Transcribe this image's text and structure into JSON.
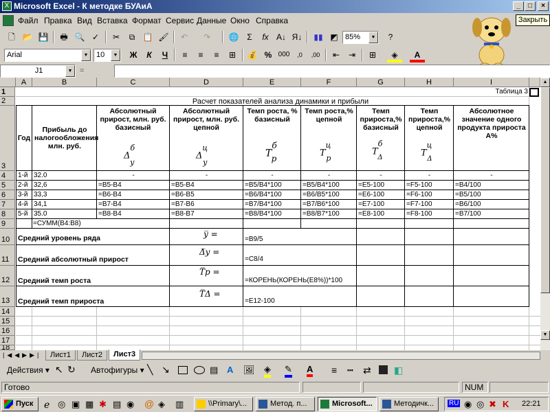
{
  "window": {
    "title": "Microsoft Excel - К методке БУАиА",
    "close_tooltip": "Закрыть"
  },
  "menu": [
    "Файл",
    "Правка",
    "Вид",
    "Вставка",
    "Формат",
    "Сервис",
    "Данные",
    "Окно",
    "Справка"
  ],
  "toolbar": {
    "zoom": "85%",
    "font": "Arial",
    "size": "10",
    "bold": "Ж",
    "italic": "К",
    "underline": "Ч",
    "percent": "%",
    "thousands": "000"
  },
  "formula": {
    "namebox": "J1",
    "content": ""
  },
  "columns": [
    "A",
    "B",
    "C",
    "D",
    "E",
    "F",
    "G",
    "H",
    "I"
  ],
  "rows": [
    "1",
    "2",
    "3",
    "4",
    "5",
    "6",
    "7",
    "8",
    "9",
    "10",
    "11",
    "12",
    "13",
    "14",
    "15",
    "16",
    "17",
    "18"
  ],
  "sheet": {
    "table_no": "Таблица 3",
    "title": "Расчет показателей анализа динамики и прибыли",
    "headers": {
      "A": "Год",
      "B": "Прибыль до налогообложения млн. руб.",
      "C": "Абсолютный прирост, млн. руб. базисный",
      "D": "Абсолютный прирост, млн. руб. цепной",
      "E": "Темп роста, % базисный",
      "F": "Темп роста,% цепной",
      "G": "Темп прироста,% базисный",
      "H": "Темп прироста,% цепной",
      "I": "Абсолютное значение одного продукта прироста А%"
    },
    "symbols": {
      "C": "Δ",
      "C_sup": "б",
      "C_sub": "у",
      "D": "Δ",
      "D_sup": "ц",
      "D_sub": "у",
      "E": "Т",
      "E_sup": "б",
      "E_sub": "р",
      "F": "Т",
      "F_sup": "ц",
      "F_sub": "р",
      "G": "Т",
      "G_sup": "б",
      "G_sub": "Δ",
      "H": "Т",
      "H_sup": "ц",
      "H_sub": "Δ"
    },
    "data": [
      [
        "1-й",
        "32.0",
        "-",
        "-",
        "-",
        "-",
        "-",
        "-",
        "-"
      ],
      [
        "2-й",
        "32,6",
        "=B5-B4",
        "=B5-B4",
        "=B5/B4*100",
        "=B5/B4*100",
        "=E5-100",
        "=F5-100",
        "=B4/100"
      ],
      [
        "3-й",
        "33,3",
        "=B6-B4",
        "=B6-B5",
        "=B6/B4*100",
        "=B6/B5*100",
        "=E6-100",
        "=F6-100",
        "=B5/100"
      ],
      [
        "4-й",
        "34,1",
        "=B7-B4",
        "=B7-B6",
        "=B7/B4*100",
        "=B7/B6*100",
        "=E7-100",
        "=F7-100",
        "=B6/100"
      ],
      [
        "5-й",
        "35.0",
        "=B8-B4",
        "=B8-B7",
        "=B8/B4*100",
        "=B8/B7*100",
        "=E8-100",
        "=F8-100",
        "=B7/100"
      ]
    ],
    "row9": "=СУММ(B4:B8)",
    "summary": [
      {
        "label": "Средний уровень ряда",
        "symbol": "y̅ =",
        "value": "=B9/5"
      },
      {
        "label": "Средний абсолютный прирост",
        "symbol": "Δ̅y =",
        "value": "=C8/4"
      },
      {
        "label": "Средний темп роста",
        "symbol": "T̅р =",
        "value": "=КОРЕНЬ(КОРЕНЬ(E8%))*100"
      },
      {
        "label": "Средний темп прироста",
        "symbol": "T̅Δ =",
        "value": "=E12-100"
      }
    ]
  },
  "tabs": [
    "Лист1",
    "Лист2",
    "Лист3"
  ],
  "drawing": {
    "actions": "Действия",
    "autoshapes": "Автофигуры"
  },
  "status": {
    "ready": "Готово",
    "num": "NUM"
  },
  "taskbar": {
    "start": "Пуск",
    "tasks": [
      "\\\\Primary\\...",
      "Метод. п...",
      "Microsoft...",
      "Методичк..."
    ],
    "lang": "RU",
    "clock": "22:21"
  }
}
